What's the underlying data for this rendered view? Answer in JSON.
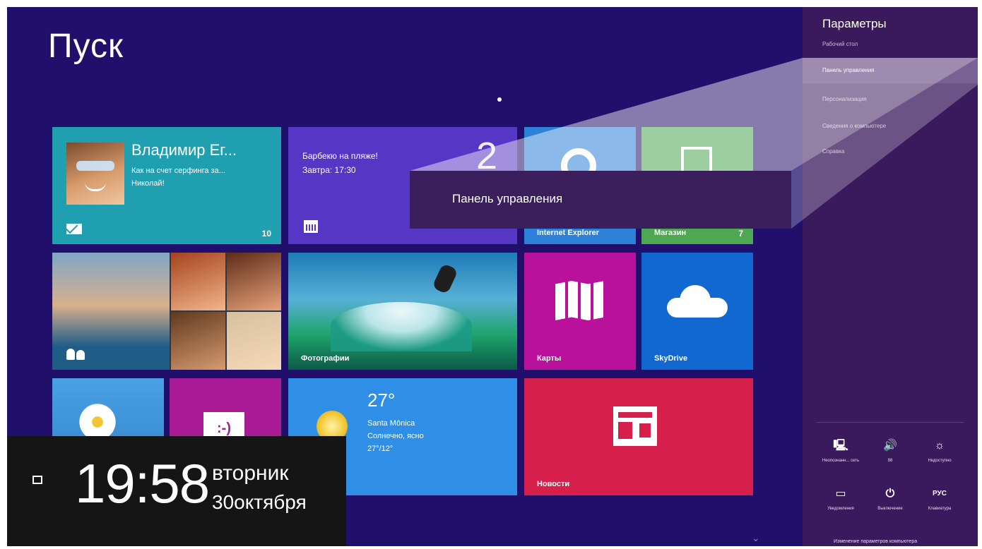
{
  "start": {
    "title": "Пуск"
  },
  "tiles": {
    "mail": {
      "name": "Владимир Ег...",
      "line1": "Как на счет серфинга за...",
      "line2": "Николай!",
      "badge": "10"
    },
    "calendar": {
      "line1": "Барбекю на пляже!",
      "line2": "Завтра: 17:30",
      "number": "2"
    },
    "ie": {
      "label": "Internet Explorer"
    },
    "store": {
      "label": "Магазин",
      "badge": "7"
    },
    "photos": {
      "label": "Фотографии"
    },
    "maps": {
      "label": "Карты"
    },
    "skydrive": {
      "label": "SkyDrive"
    },
    "messaging": {
      "emoticon": ":-)"
    },
    "weather": {
      "temp": "27°",
      "city": "Santa Mônica",
      "cond": "Солнечно, ясно",
      "range": "27°/12°"
    },
    "news": {
      "label": "Новости"
    }
  },
  "clock": {
    "time": "19:58",
    "day": "вторник",
    "date": "30октября"
  },
  "settings": {
    "title": "Параметры",
    "items": [
      {
        "label": "Рабочий стол"
      },
      {
        "label": "Панель управления"
      },
      {
        "label": "Персонализация"
      },
      {
        "label": "Сведения о компьютере"
      },
      {
        "label": "Справка"
      }
    ],
    "quick": [
      {
        "icon": "network-icon",
        "glyph": "🖳",
        "label": "Неопознанн... сеть"
      },
      {
        "icon": "volume-icon",
        "glyph": "🔊",
        "label": "98"
      },
      {
        "icon": "brightness-icon",
        "glyph": "☼",
        "label": "Недоступно"
      },
      {
        "icon": "notifications-icon",
        "glyph": "▭",
        "label": "Уведомления"
      },
      {
        "icon": "power-icon",
        "glyph": "⏻",
        "label": "Выключение"
      },
      {
        "icon": "keyboard-icon",
        "glyph": "РУС",
        "label": "Клавиатура"
      }
    ],
    "footer": "Изменение параметров компьютера"
  },
  "callout": {
    "text": "Панель управления"
  },
  "colors": {
    "background": "#21106b",
    "charm": "#3a1a5c",
    "accent_mail": "#1f9fb0",
    "accent_news": "#d6204b"
  }
}
